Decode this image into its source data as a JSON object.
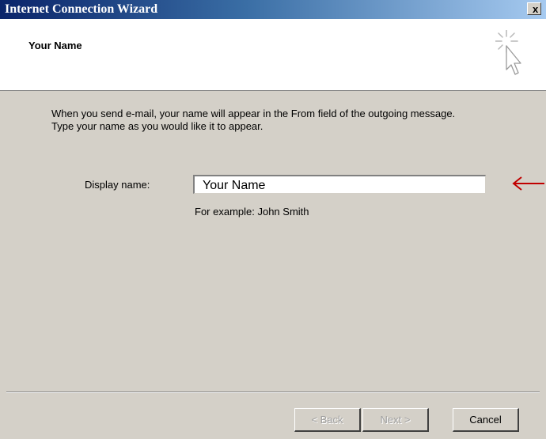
{
  "window": {
    "title": "Internet Connection Wizard",
    "close_label": "x"
  },
  "header": {
    "title": "Your Name",
    "icon": "wizard-cursor-sparkle-icon"
  },
  "body": {
    "description_line1": "When you send e-mail, your name will appear in the From field of the outgoing message.",
    "description_line2": "Type your name as you would like it to appear.",
    "display_name_label": "Display name:",
    "display_name_value": "Your Name",
    "example_text": "For example: John Smith"
  },
  "annotation": {
    "icon": "red-left-arrow-icon",
    "color": "#c00000"
  },
  "buttons": {
    "back_label": "< Back",
    "next_label": "Next >",
    "cancel_label": "Cancel"
  },
  "colors": {
    "titlebar_start": "#0a246a",
    "titlebar_end": "#a6caf0",
    "dialog_background": "#d4d0c8",
    "header_background": "#ffffff"
  }
}
